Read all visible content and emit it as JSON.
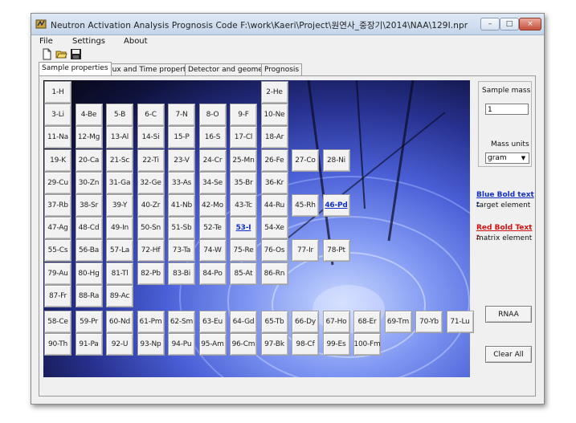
{
  "window": {
    "title": "Neutron Activation Analysis Prognosis Code F:\\work\\Kaeri\\Project\\원연사_중장기\\2014\\NAA\\129I.npr",
    "controls": {
      "minimize": "–",
      "maximize": "□",
      "close": "×"
    }
  },
  "menu": [
    "File",
    "Settings",
    "About"
  ],
  "toolbar": [
    {
      "name": "new-file-icon"
    },
    {
      "name": "open-folder-icon"
    },
    {
      "name": "save-icon"
    }
  ],
  "tabs": [
    "Sample properties",
    "Flux and Time properties",
    "Detector and geometry",
    "Prognosis"
  ],
  "active_tab": 0,
  "periodic_table": [
    [
      "1-H",
      null,
      null,
      null,
      null,
      null,
      null,
      "2-He"
    ],
    [
      "3-Li",
      "4-Be",
      "5-B",
      "6-C",
      "7-N",
      "8-O",
      "9-F",
      "10-Ne"
    ],
    [
      "11-Na",
      "12-Mg",
      "13-Al",
      "14-Si",
      "15-P",
      "16-S",
      "17-Cl",
      "18-Ar"
    ],
    [
      "19-K",
      "20-Ca",
      "21-Sc",
      "22-Ti",
      "23-V",
      "24-Cr",
      "25-Mn",
      "26-Fe",
      "27-Co",
      "28-Ni"
    ],
    [
      "29-Cu",
      "30-Zn",
      "31-Ga",
      "32-Ge",
      "33-As",
      "34-Se",
      "35-Br",
      "36-Kr"
    ],
    [
      "37-Rb",
      "38-Sr",
      "39-Y",
      "40-Zr",
      "41-Nb",
      "42-Mo",
      "43-Tc",
      "44-Ru",
      "45-Rh",
      "46-Pd"
    ],
    [
      "47-Ag",
      "48-Cd",
      "49-In",
      "50-Sn",
      "51-Sb",
      "52-Te",
      "53-I",
      "54-Xe"
    ],
    [
      "55-Cs",
      "56-Ba",
      "57-La",
      "72-Hf",
      "73-Ta",
      "74-W",
      "75-Re",
      "76-Os",
      "77-Ir",
      "78-Pt"
    ],
    [
      "79-Au",
      "80-Hg",
      "81-Tl",
      "82-Pb",
      "83-Bi",
      "84-Po",
      "85-At",
      "86-Rn"
    ],
    [
      "87-Fr",
      "88-Ra",
      "89-Ac"
    ],
    [
      "58-Ce",
      "59-Pr",
      "60-Nd",
      "61-Pm",
      "62-Sm",
      "63-Eu",
      "64-Gd",
      "65-Tb",
      "66-Dy",
      "67-Ho",
      "68-Er",
      "69-Tm",
      "70-Yb",
      "71-Lu"
    ],
    [
      "90-Th",
      "91-Pa",
      "92-U",
      "93-Np",
      "94-Pu",
      "95-Am",
      "96-Cm",
      "97-Bk",
      "98-Cf",
      "99-Es",
      "100-Fm"
    ]
  ],
  "target_elements": [
    "46-Pd",
    "53-I"
  ],
  "sample": {
    "mass_label": "Sample mass",
    "mass_value": "1",
    "units_label": "Mass units",
    "units_value": "gram"
  },
  "legend": {
    "blue_title": "Blue Bold text -",
    "blue_desc": "target element",
    "red_title": "Red Bold Text -",
    "red_desc": "matrix element"
  },
  "buttons": {
    "rnaa": "RNAA",
    "clear_all": "Clear All"
  },
  "colors": {
    "target_text": "#1230c8",
    "matrix_text": "#d01010"
  }
}
